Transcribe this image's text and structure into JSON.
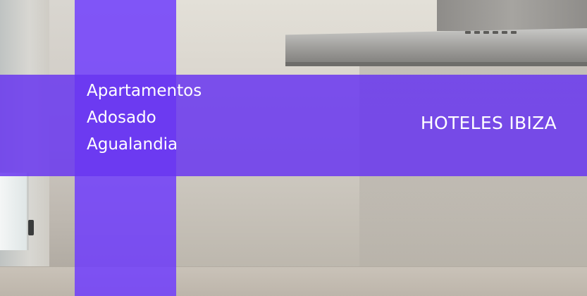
{
  "property": {
    "name_lines": [
      "Apartamentos",
      "Adosado",
      "Agualandia"
    ]
  },
  "brand": {
    "label": "HOTELES IBIZA"
  },
  "colors": {
    "overlay_accent": "#6c38ff",
    "text": "#ffffff"
  },
  "background": {
    "icon": "kitchen-photo"
  }
}
